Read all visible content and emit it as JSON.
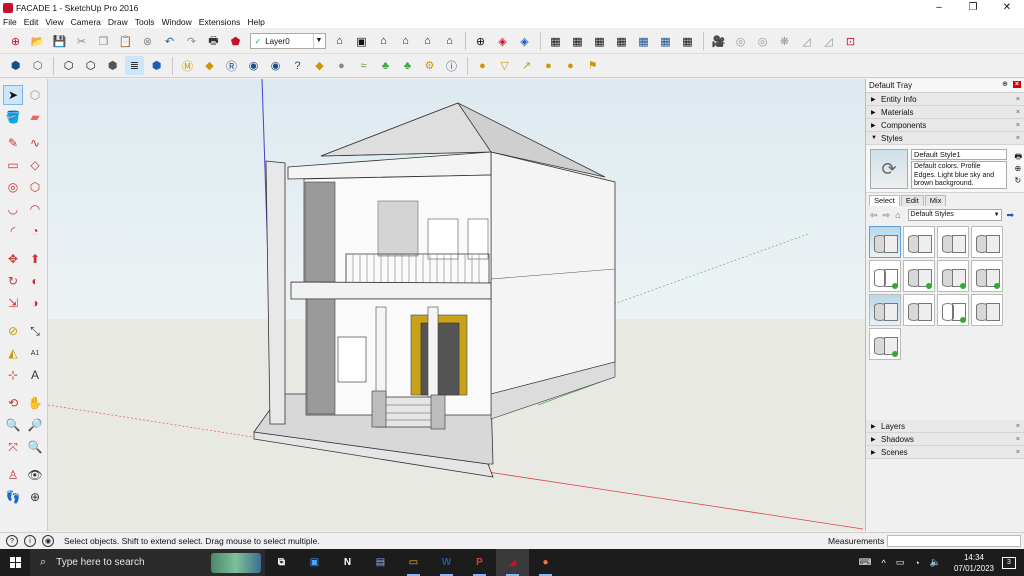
{
  "window": {
    "title": "FACADE 1 - SketchUp Pro 2016",
    "controls": [
      "–",
      "❐",
      "✕"
    ]
  },
  "menu": [
    "File",
    "Edit",
    "View",
    "Camera",
    "Draw",
    "Tools",
    "Window",
    "Extensions",
    "Help"
  ],
  "toolbar": {
    "layer_value": "Layer0",
    "layer_check": "✓"
  },
  "tray": {
    "title": "Default Tray",
    "pin": "⊕",
    "close": "×",
    "panels_top": [
      {
        "label": "Entity Info",
        "state": "▶"
      },
      {
        "label": "Materials",
        "state": "▶"
      },
      {
        "label": "Components",
        "state": "▶"
      }
    ],
    "styles_panel": {
      "label": "Styles",
      "state": "▼",
      "style_name": "Default Style1",
      "description": "Default colors. Profile Edges. Light blue sky and brown background.",
      "tabs": [
        "Select",
        "Edit",
        "Mix"
      ],
      "library": "Default Styles"
    },
    "panels_bottom": [
      {
        "label": "Layers",
        "state": "▶"
      },
      {
        "label": "Shadows",
        "state": "▶"
      },
      {
        "label": "Scenes",
        "state": "▶"
      }
    ]
  },
  "status": {
    "message": "Select objects. Shift to extend select. Drag mouse to select multiple.",
    "measurements_label": "Measurements",
    "measurements_value": ""
  },
  "taskbar": {
    "search_placeholder": "Type here to search",
    "time": "14:34",
    "date": "07/01/2023",
    "notifications": "3"
  },
  "colors": {
    "sketchup_red": "#c8102e",
    "sky": "#ddeaf0",
    "ground": "#e9e9e4",
    "axis_red": "#d44",
    "axis_green": "#5a5",
    "axis_blue": "#44c",
    "taskbar": "#1c1c1c"
  }
}
